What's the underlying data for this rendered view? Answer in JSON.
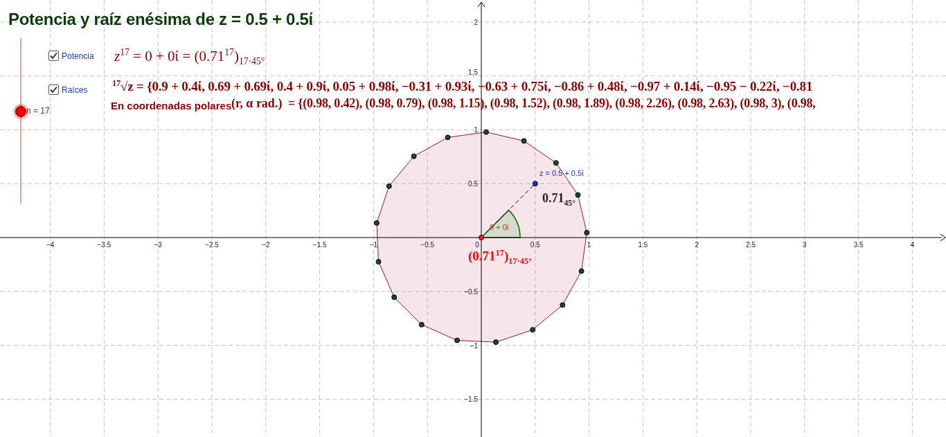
{
  "title": "Potencia y raíz enésima de z = 0.5 + 0.5ί",
  "checkboxes": [
    {
      "label": "Potencia",
      "checked": true
    },
    {
      "label": "Raíces",
      "checked": true
    }
  ],
  "slider": {
    "label": "n = 17",
    "level": 0.56
  },
  "power_formula": "*z*$^{17}$ = 0 + 0ί = (0.71$^{17}$)$_{17·45°}$",
  "roots_formula": "$^{17}$√z = {0.9 + 0.4ί, 0.69 + 0.69ί, 0.4 + 0.9ί, 0.05 + 0.98ί, −0.31 + 0.93ί, −0.63 + 0.75ί, −0.86 + 0.48ί, −0.97 + 0.14ί, −0.95 − 0.22ί, −0.81",
  "polar": {
    "label": "En coordenadas polares",
    "notation": "(r, α rad.)",
    "value": "= {(0.98, 0.42), (0.98, 0.79), (0.98, 1.15), (0.98, 1.52), (0.98, 1.89), (0.98, 2.26), (0.98, 2.63), (0.98, 3), (0.98,"
  },
  "graph": {
    "x_ticks": [
      "−4",
      "−3.5",
      "−3",
      "−2.5",
      "−2",
      "−1.5",
      "−1",
      "−0.5",
      "0",
      "0.5",
      "1",
      "1.5",
      "2",
      "2.5",
      "3",
      "3.5",
      "4"
    ],
    "y_ticks": [
      "2",
      "1.5",
      "1",
      "0.5",
      "−0.5",
      "−1",
      "−1.5"
    ],
    "z_label": "z = 0.5 + 0.5ί",
    "modulus_label": "0.71$_{45°}$",
    "origin_label": "0 + 0ί",
    "power_label": "(0.71$^{17}$)$_{17·45°}$"
  }
}
